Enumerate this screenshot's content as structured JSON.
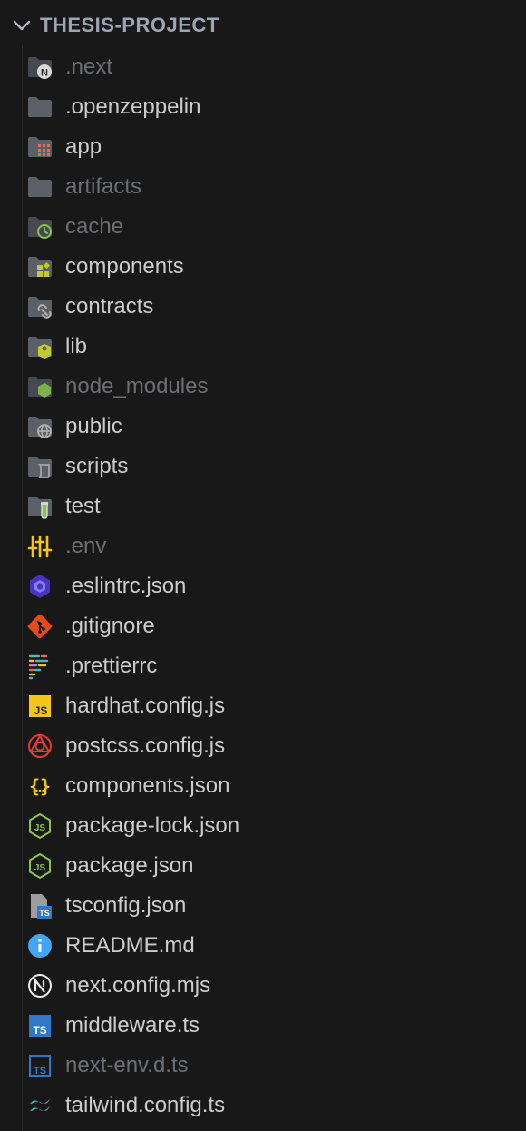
{
  "explorer": {
    "project_name": "THESIS-PROJECT",
    "items": [
      {
        "label": ".next",
        "kind": "folder",
        "icon": "folder-next-icon",
        "dimmed": true
      },
      {
        "label": ".openzeppelin",
        "kind": "folder",
        "icon": "folder-icon",
        "dimmed": false
      },
      {
        "label": "app",
        "kind": "folder",
        "icon": "folder-app-icon",
        "dimmed": false
      },
      {
        "label": "artifacts",
        "kind": "folder",
        "icon": "folder-icon",
        "dimmed": true
      },
      {
        "label": "cache",
        "kind": "folder",
        "icon": "folder-cache-icon",
        "dimmed": true
      },
      {
        "label": "components",
        "kind": "folder",
        "icon": "folder-components-icon",
        "dimmed": false
      },
      {
        "label": "contracts",
        "kind": "folder",
        "icon": "folder-contracts-icon",
        "dimmed": false
      },
      {
        "label": "lib",
        "kind": "folder",
        "icon": "folder-lib-icon",
        "dimmed": false
      },
      {
        "label": "node_modules",
        "kind": "folder",
        "icon": "folder-node-icon",
        "dimmed": true
      },
      {
        "label": "public",
        "kind": "folder",
        "icon": "folder-public-icon",
        "dimmed": false
      },
      {
        "label": "scripts",
        "kind": "folder",
        "icon": "folder-scripts-icon",
        "dimmed": false
      },
      {
        "label": "test",
        "kind": "folder",
        "icon": "folder-test-icon",
        "dimmed": false
      },
      {
        "label": ".env",
        "kind": "file",
        "icon": "env-settings-icon",
        "dimmed": true
      },
      {
        "label": ".eslintrc.json",
        "kind": "file",
        "icon": "eslint-icon",
        "dimmed": false
      },
      {
        "label": ".gitignore",
        "kind": "file",
        "icon": "git-icon",
        "dimmed": false
      },
      {
        "label": ".prettierrc",
        "kind": "file",
        "icon": "prettier-icon",
        "dimmed": false
      },
      {
        "label": "hardhat.config.js",
        "kind": "file",
        "icon": "javascript-icon",
        "dimmed": false
      },
      {
        "label": "postcss.config.js",
        "kind": "file",
        "icon": "postcss-icon",
        "dimmed": false
      },
      {
        "label": "components.json",
        "kind": "file",
        "icon": "json-braces-icon",
        "dimmed": false
      },
      {
        "label": "package-lock.json",
        "kind": "file",
        "icon": "nodejs-icon",
        "dimmed": false
      },
      {
        "label": "package.json",
        "kind": "file",
        "icon": "nodejs-icon",
        "dimmed": false
      },
      {
        "label": "tsconfig.json",
        "kind": "file",
        "icon": "tsconfig-icon",
        "dimmed": false
      },
      {
        "label": "README.md",
        "kind": "file",
        "icon": "info-icon",
        "dimmed": false
      },
      {
        "label": "next.config.mjs",
        "kind": "file",
        "icon": "nextjs-icon",
        "dimmed": false
      },
      {
        "label": "middleware.ts",
        "kind": "file",
        "icon": "typescript-icon",
        "dimmed": false
      },
      {
        "label": "next-env.d.ts",
        "kind": "file",
        "icon": "typescript-def-icon",
        "dimmed": true
      },
      {
        "label": "tailwind.config.ts",
        "kind": "file",
        "icon": "tailwind-icon",
        "dimmed": false
      }
    ]
  },
  "colors": {
    "background": "#181818",
    "text": "#cccccc",
    "text_dim": "#6b6f76",
    "folder": "#5b5f66",
    "accent_green": "#8bc34a",
    "accent_yellow": "#f5c518",
    "typescript_blue": "#3178c6"
  }
}
